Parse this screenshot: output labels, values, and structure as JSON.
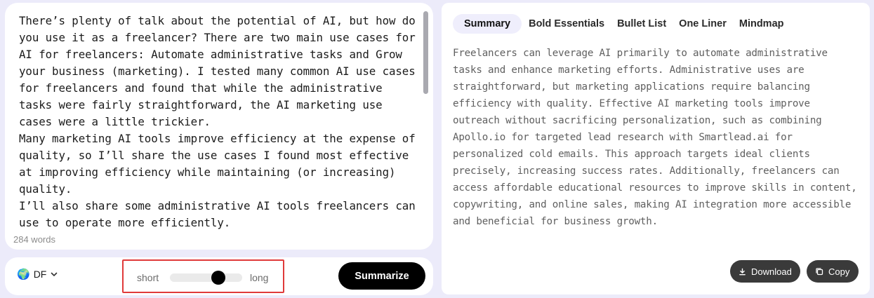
{
  "input": {
    "paragraphs": [
      "There’s plenty of talk about the potential of AI, but how do you use it as a freelancer? There are two main use cases for AI for freelancers: Automate administrative tasks and Grow your business (marketing). I tested many common AI use cases for freelancers and found that while the administrative tasks were fairly straightforward, the AI marketing use cases were a little trickier.",
      "Many marketing AI tools improve efficiency at the expense of quality, so I’ll share the use cases I found most effective at improving efficiency while maintaining (or increasing) quality.",
      "I’ll also share some administrative AI tools freelancers can use to operate more efficiently."
    ],
    "word_count": "284 words"
  },
  "controls": {
    "language": "DF",
    "language_icon": "🌍",
    "length_short_label": "short",
    "length_long_label": "long",
    "length_level": 0.67,
    "summarize_label": "Summarize"
  },
  "output": {
    "tabs": [
      {
        "label": "Summary",
        "active": true
      },
      {
        "label": "Bold Essentials",
        "active": false
      },
      {
        "label": "Bullet List",
        "active": false
      },
      {
        "label": "One Liner",
        "active": false
      },
      {
        "label": "Mindmap",
        "active": false
      }
    ],
    "summary": "Freelancers can leverage AI primarily to automate administrative tasks and enhance marketing efforts. Administrative uses are straightforward, but marketing applications require balancing efficiency with quality. Effective AI marketing tools improve outreach without sacrificing personalization, such as combining Apollo.io for targeted lead research with Smartlead.ai for personalized cold emails. This approach targets ideal clients precisely, increasing success rates. Additionally, freelancers can access affordable educational resources to improve skills in content, copywriting, and online sales, making AI integration more accessible and beneficial for business growth.",
    "download_label": "Download",
    "copy_label": "Copy"
  },
  "colors": {
    "page_bg": "#ecebfa",
    "active_tab_bg": "#efeefc",
    "primary_button": "#000000",
    "secondary_button": "#3a3a3a",
    "highlight_border": "#e03a3a"
  }
}
